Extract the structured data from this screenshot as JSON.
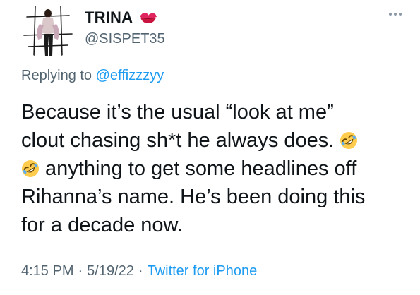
{
  "author": {
    "display_name": "TRINA",
    "handle": "@SISPET35",
    "name_emoji": "kiss-mark-icon"
  },
  "reply": {
    "prefix": "Replying to",
    "mention": "@effizzzyy"
  },
  "tweet": {
    "line1": "Because it’s the usual “look at me”",
    "line2_text": "clout chasing sh*t he always does.",
    "line3_text": " anything to get some headlines off",
    "line4": "Rihanna’s name. He’s been doing this",
    "line5": "for a decade now.",
    "emoji": "rolling-on-floor-laughing-icon"
  },
  "meta": {
    "time": "4:15 PM",
    "date": "5/19/22",
    "source": "Twitter for iPhone",
    "separator": "·"
  },
  "colors": {
    "text": "#0f1419",
    "secondary": "#536471",
    "link": "#1d9bf0"
  }
}
